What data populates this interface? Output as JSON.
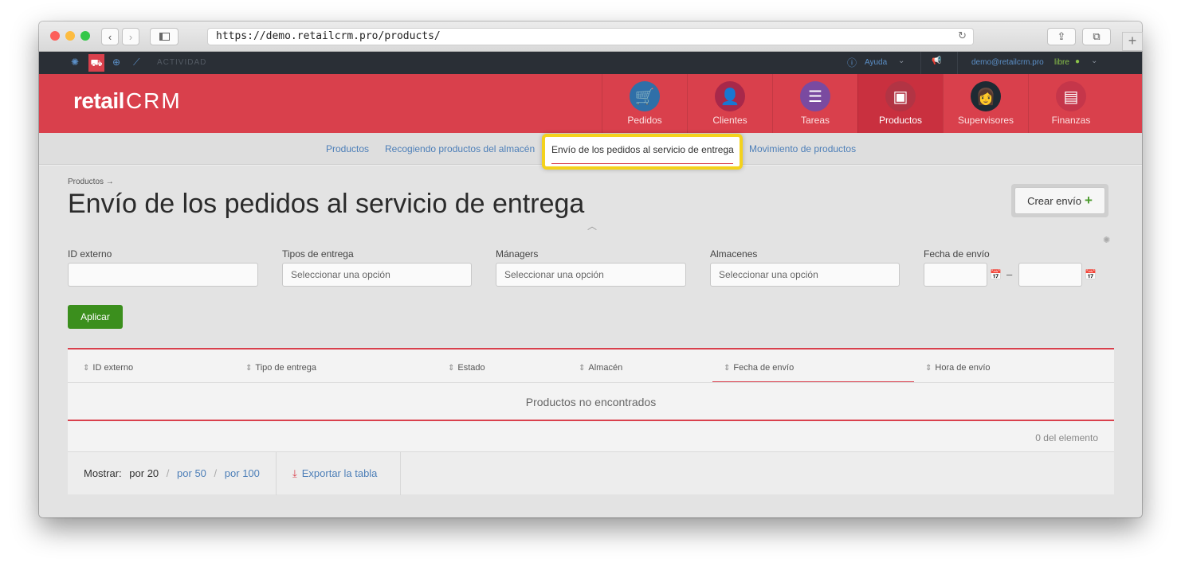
{
  "browser": {
    "url": "https://demo.retailcrm.pro/products/"
  },
  "topbar": {
    "activity": "ACTIVIDAD",
    "help": "Ayuda",
    "user": "demo@retailcrm.pro",
    "plan": "libre"
  },
  "logo": {
    "retail": "retail",
    "crm": "CRM"
  },
  "nav": [
    {
      "label": "Pedidos",
      "icon": "cart-icon",
      "color": "#2f6fa8"
    },
    {
      "label": "Clientes",
      "icon": "person-icon",
      "color": "#a8284a"
    },
    {
      "label": "Tareas",
      "icon": "chat-icon",
      "color": "#7a4aa0"
    },
    {
      "label": "Productos",
      "icon": "box-icon",
      "color": "#b23444"
    },
    {
      "label": "Supervisores",
      "icon": "supervisor-icon",
      "color": "#1e2a33"
    },
    {
      "label": "Finanzas",
      "icon": "ledger-icon",
      "color": "#c5364a"
    }
  ],
  "subnav": {
    "productos": "Productos",
    "recogiendo": "Recogiendo productos del almacén",
    "envio": "Envío de los pedidos al servicio de entrega",
    "movimiento": "Movimiento de productos"
  },
  "page": {
    "breadcrumb": "Productos →",
    "title": "Envío de los pedidos al servicio de entrega",
    "create": "Crear envío"
  },
  "filters": {
    "id_externo": {
      "label": "ID externo",
      "value": ""
    },
    "tipos": {
      "label": "Tipos de entrega",
      "placeholder": "Seleccionar una opción"
    },
    "managers": {
      "label": "Mánagers",
      "placeholder": "Seleccionar una opción"
    },
    "almacenes": {
      "label": "Almacenes",
      "placeholder": "Seleccionar una opción"
    },
    "fecha": {
      "label": "Fecha de envío",
      "dash": "–"
    },
    "apply": "Aplicar"
  },
  "table": {
    "columns": [
      "ID externo",
      "Tipo de entrega",
      "Estado",
      "Almacén",
      "Fecha de envío",
      "Hora de envío"
    ],
    "empty": "Productos no encontrados",
    "count": "0 del elemento",
    "show_label": "Mostrar:",
    "per": [
      "por 20",
      "por 50",
      "por 100"
    ],
    "export": "Exportar la tabla"
  },
  "colors": {
    "brand_red": "#d9404c",
    "apply_green": "#3b8f1d",
    "link_blue": "#4d7fb8",
    "highlight": "#f4d21c"
  }
}
